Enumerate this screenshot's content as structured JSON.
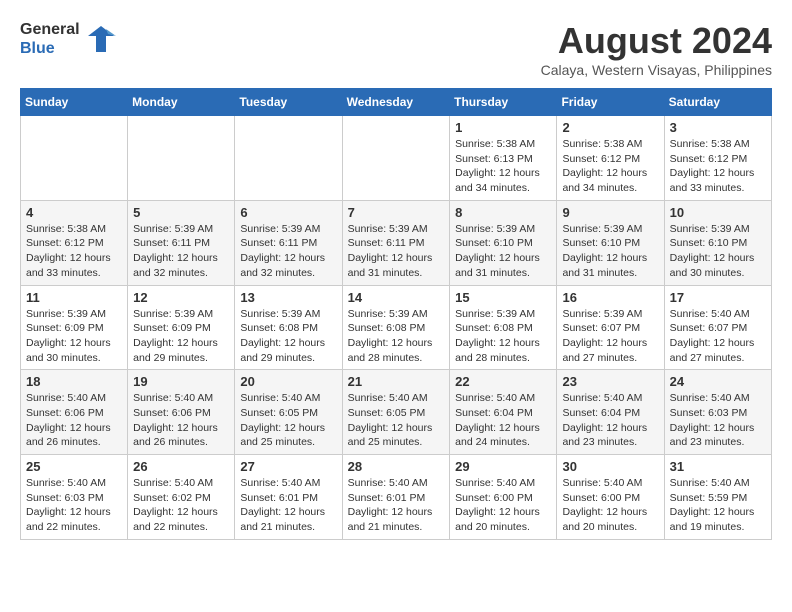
{
  "logo": {
    "text_general": "General",
    "text_blue": "Blue"
  },
  "title": {
    "month_year": "August 2024",
    "location": "Calaya, Western Visayas, Philippines"
  },
  "header_days": [
    "Sunday",
    "Monday",
    "Tuesday",
    "Wednesday",
    "Thursday",
    "Friday",
    "Saturday"
  ],
  "weeks": [
    [
      {
        "num": "",
        "info": ""
      },
      {
        "num": "",
        "info": ""
      },
      {
        "num": "",
        "info": ""
      },
      {
        "num": "",
        "info": ""
      },
      {
        "num": "1",
        "info": "Sunrise: 5:38 AM\nSunset: 6:13 PM\nDaylight: 12 hours\nand 34 minutes."
      },
      {
        "num": "2",
        "info": "Sunrise: 5:38 AM\nSunset: 6:12 PM\nDaylight: 12 hours\nand 34 minutes."
      },
      {
        "num": "3",
        "info": "Sunrise: 5:38 AM\nSunset: 6:12 PM\nDaylight: 12 hours\nand 33 minutes."
      }
    ],
    [
      {
        "num": "4",
        "info": "Sunrise: 5:38 AM\nSunset: 6:12 PM\nDaylight: 12 hours\nand 33 minutes."
      },
      {
        "num": "5",
        "info": "Sunrise: 5:39 AM\nSunset: 6:11 PM\nDaylight: 12 hours\nand 32 minutes."
      },
      {
        "num": "6",
        "info": "Sunrise: 5:39 AM\nSunset: 6:11 PM\nDaylight: 12 hours\nand 32 minutes."
      },
      {
        "num": "7",
        "info": "Sunrise: 5:39 AM\nSunset: 6:11 PM\nDaylight: 12 hours\nand 31 minutes."
      },
      {
        "num": "8",
        "info": "Sunrise: 5:39 AM\nSunset: 6:10 PM\nDaylight: 12 hours\nand 31 minutes."
      },
      {
        "num": "9",
        "info": "Sunrise: 5:39 AM\nSunset: 6:10 PM\nDaylight: 12 hours\nand 31 minutes."
      },
      {
        "num": "10",
        "info": "Sunrise: 5:39 AM\nSunset: 6:10 PM\nDaylight: 12 hours\nand 30 minutes."
      }
    ],
    [
      {
        "num": "11",
        "info": "Sunrise: 5:39 AM\nSunset: 6:09 PM\nDaylight: 12 hours\nand 30 minutes."
      },
      {
        "num": "12",
        "info": "Sunrise: 5:39 AM\nSunset: 6:09 PM\nDaylight: 12 hours\nand 29 minutes."
      },
      {
        "num": "13",
        "info": "Sunrise: 5:39 AM\nSunset: 6:08 PM\nDaylight: 12 hours\nand 29 minutes."
      },
      {
        "num": "14",
        "info": "Sunrise: 5:39 AM\nSunset: 6:08 PM\nDaylight: 12 hours\nand 28 minutes."
      },
      {
        "num": "15",
        "info": "Sunrise: 5:39 AM\nSunset: 6:08 PM\nDaylight: 12 hours\nand 28 minutes."
      },
      {
        "num": "16",
        "info": "Sunrise: 5:39 AM\nSunset: 6:07 PM\nDaylight: 12 hours\nand 27 minutes."
      },
      {
        "num": "17",
        "info": "Sunrise: 5:40 AM\nSunset: 6:07 PM\nDaylight: 12 hours\nand 27 minutes."
      }
    ],
    [
      {
        "num": "18",
        "info": "Sunrise: 5:40 AM\nSunset: 6:06 PM\nDaylight: 12 hours\nand 26 minutes."
      },
      {
        "num": "19",
        "info": "Sunrise: 5:40 AM\nSunset: 6:06 PM\nDaylight: 12 hours\nand 26 minutes."
      },
      {
        "num": "20",
        "info": "Sunrise: 5:40 AM\nSunset: 6:05 PM\nDaylight: 12 hours\nand 25 minutes."
      },
      {
        "num": "21",
        "info": "Sunrise: 5:40 AM\nSunset: 6:05 PM\nDaylight: 12 hours\nand 25 minutes."
      },
      {
        "num": "22",
        "info": "Sunrise: 5:40 AM\nSunset: 6:04 PM\nDaylight: 12 hours\nand 24 minutes."
      },
      {
        "num": "23",
        "info": "Sunrise: 5:40 AM\nSunset: 6:04 PM\nDaylight: 12 hours\nand 23 minutes."
      },
      {
        "num": "24",
        "info": "Sunrise: 5:40 AM\nSunset: 6:03 PM\nDaylight: 12 hours\nand 23 minutes."
      }
    ],
    [
      {
        "num": "25",
        "info": "Sunrise: 5:40 AM\nSunset: 6:03 PM\nDaylight: 12 hours\nand 22 minutes."
      },
      {
        "num": "26",
        "info": "Sunrise: 5:40 AM\nSunset: 6:02 PM\nDaylight: 12 hours\nand 22 minutes."
      },
      {
        "num": "27",
        "info": "Sunrise: 5:40 AM\nSunset: 6:01 PM\nDaylight: 12 hours\nand 21 minutes."
      },
      {
        "num": "28",
        "info": "Sunrise: 5:40 AM\nSunset: 6:01 PM\nDaylight: 12 hours\nand 21 minutes."
      },
      {
        "num": "29",
        "info": "Sunrise: 5:40 AM\nSunset: 6:00 PM\nDaylight: 12 hours\nand 20 minutes."
      },
      {
        "num": "30",
        "info": "Sunrise: 5:40 AM\nSunset: 6:00 PM\nDaylight: 12 hours\nand 20 minutes."
      },
      {
        "num": "31",
        "info": "Sunrise: 5:40 AM\nSunset: 5:59 PM\nDaylight: 12 hours\nand 19 minutes."
      }
    ]
  ]
}
